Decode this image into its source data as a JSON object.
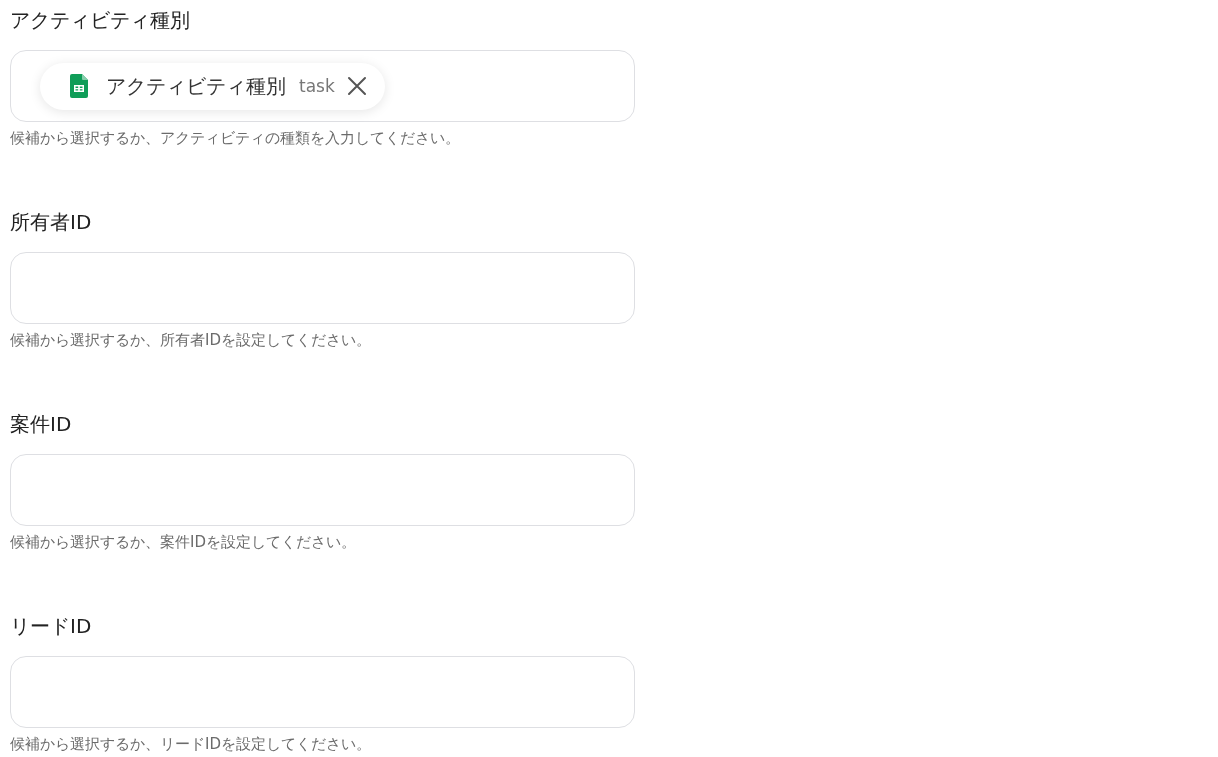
{
  "fields": [
    {
      "label": "アクティビティ種別",
      "value": {
        "text": "アクティビティ種別",
        "tag": "task"
      },
      "help": "候補から選択するか、アクティビティの種類を入力してください。"
    },
    {
      "label": "所有者ID",
      "help": "候補から選択するか、所有者IDを設定してください。"
    },
    {
      "label": "案件ID",
      "help": "候補から選択するか、案件IDを設定してください。"
    },
    {
      "label": "リードID",
      "help": "候補から選択するか、リードIDを設定してください。"
    }
  ]
}
